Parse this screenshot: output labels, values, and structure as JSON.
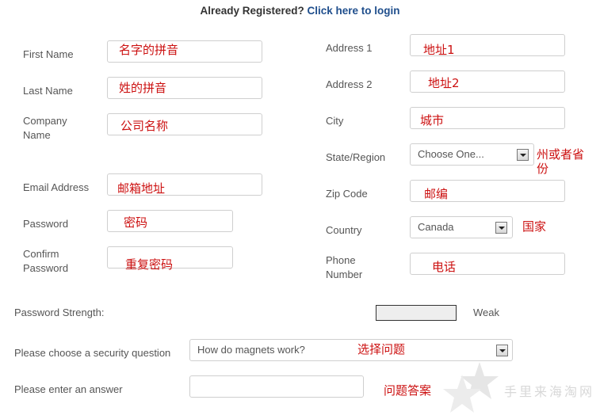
{
  "header": {
    "prompt": "Already Registered?",
    "login_link": "Click here to login"
  },
  "left_fields": [
    {
      "label": "First Name",
      "annotation": "名字的拼音"
    },
    {
      "label": "Last Name",
      "annotation": "姓的拼音"
    },
    {
      "label": "Company Name",
      "label_line1": "Company",
      "label_line2": "Name",
      "annotation": "公司名称"
    },
    {
      "label": "Email Address",
      "annotation": "邮箱地址"
    },
    {
      "label": "Password",
      "annotation": "密码"
    },
    {
      "label": "Confirm Password",
      "label_line1": "Confirm",
      "label_line2": "Password",
      "annotation": "重复密码"
    }
  ],
  "right_fields": [
    {
      "label": "Address 1",
      "annotation": "地址1"
    },
    {
      "label": "Address 2",
      "annotation": "地址2"
    },
    {
      "label": "City",
      "annotation": "城市"
    },
    {
      "label": "State/Region",
      "selected": "Choose One...",
      "annotation_line1": "州或者省",
      "annotation_line2": "份"
    },
    {
      "label": "Zip Code",
      "annotation": "邮编"
    },
    {
      "label": "Country",
      "selected": "Canada",
      "annotation": "国家"
    },
    {
      "label": "Phone Number",
      "label_line1": "Phone",
      "label_line2": "Number",
      "annotation": "电话"
    }
  ],
  "password_strength": {
    "label": "Password Strength:",
    "value": "Weak"
  },
  "security": {
    "question_label": "Please choose a security question",
    "question_selected": "How do magnets work?",
    "question_annotation": "选择问题",
    "answer_label": "Please enter an answer",
    "answer_value": "",
    "answer_annotation": "问题答案"
  },
  "watermark": {
    "text": "手里来海淘网",
    "icon": "star-icon"
  }
}
